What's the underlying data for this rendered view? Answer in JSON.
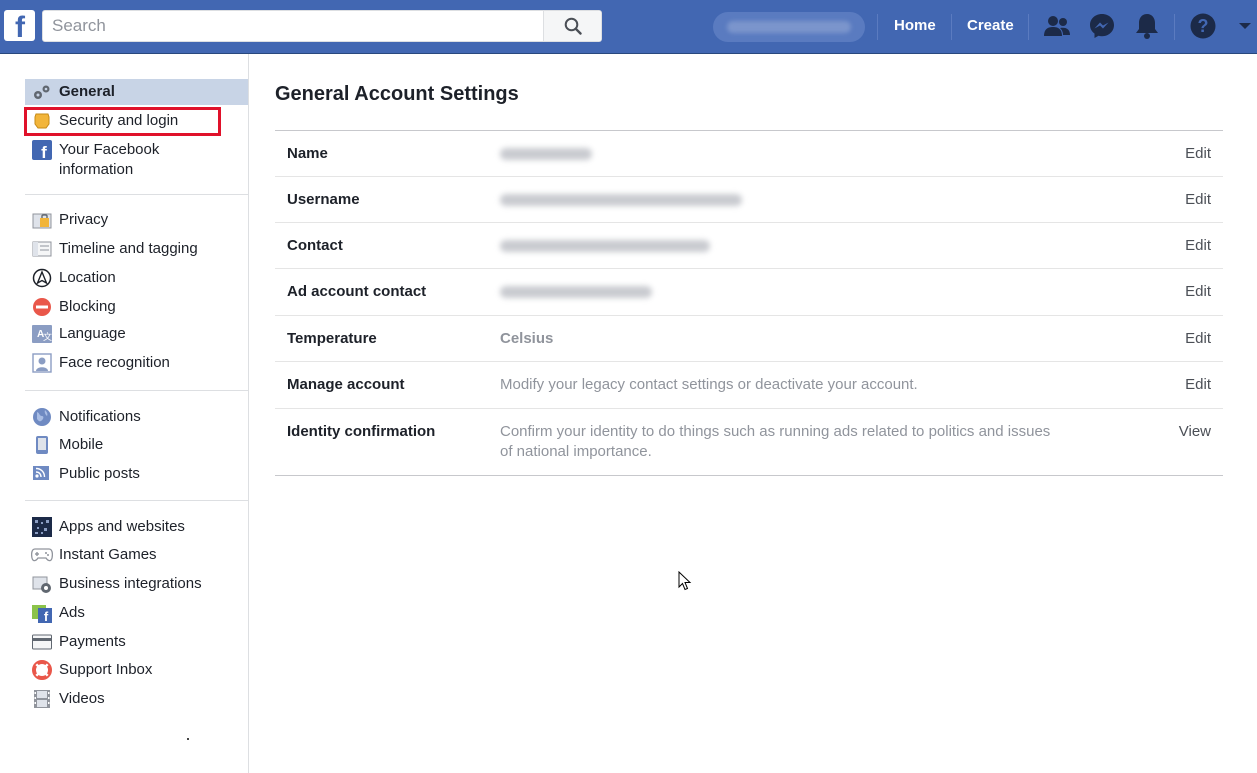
{
  "topbar": {
    "logo_letter": "f",
    "search_placeholder": "Search",
    "nav": {
      "home": "Home",
      "create": "Create"
    },
    "colors": {
      "bar": "#4267b2"
    }
  },
  "sidebar": {
    "groups": [
      [
        {
          "label": "General",
          "icon": "gears-icon",
          "active": true
        },
        {
          "label": "Security and login",
          "icon": "shield-icon",
          "highlight": true
        },
        {
          "label": "Your Facebook information",
          "icon": "facebook-square-icon"
        }
      ],
      [
        {
          "label": "Privacy",
          "icon": "lock-icon"
        },
        {
          "label": "Timeline and tagging",
          "icon": "timeline-icon"
        },
        {
          "label": "Location",
          "icon": "location-icon"
        },
        {
          "label": "Blocking",
          "icon": "block-icon"
        },
        {
          "label": "Language",
          "icon": "language-icon"
        },
        {
          "label": "Face recognition",
          "icon": "face-icon"
        }
      ],
      [
        {
          "label": "Notifications",
          "icon": "globe-icon"
        },
        {
          "label": "Mobile",
          "icon": "mobile-icon"
        },
        {
          "label": "Public posts",
          "icon": "rss-icon"
        }
      ],
      [
        {
          "label": "Apps and websites",
          "icon": "apps-icon"
        },
        {
          "label": "Instant Games",
          "icon": "gamepad-icon"
        },
        {
          "label": "Business integrations",
          "icon": "business-icon"
        },
        {
          "label": "Ads",
          "icon": "ads-icon"
        },
        {
          "label": "Payments",
          "icon": "card-icon"
        },
        {
          "label": "Support Inbox",
          "icon": "lifebuoy-icon"
        },
        {
          "label": "Videos",
          "icon": "film-icon"
        }
      ]
    ]
  },
  "main": {
    "title": "General Account Settings",
    "rows": [
      {
        "label": "Name",
        "action": "Edit"
      },
      {
        "label": "Username",
        "action": "Edit"
      },
      {
        "label": "Contact",
        "action": "Edit"
      },
      {
        "label": "Ad account contact",
        "action": "Edit"
      },
      {
        "label": "Temperature",
        "value": "Celsius",
        "action": "Edit"
      },
      {
        "label": "Manage account",
        "value": "Modify your legacy contact settings or deactivate your account.",
        "action": "Edit"
      },
      {
        "label": "Identity confirmation",
        "value_line1": "Confirm your identity to do things such as running ads related to politics and issues",
        "value_line2": "of national importance.",
        "action": "View"
      }
    ]
  }
}
